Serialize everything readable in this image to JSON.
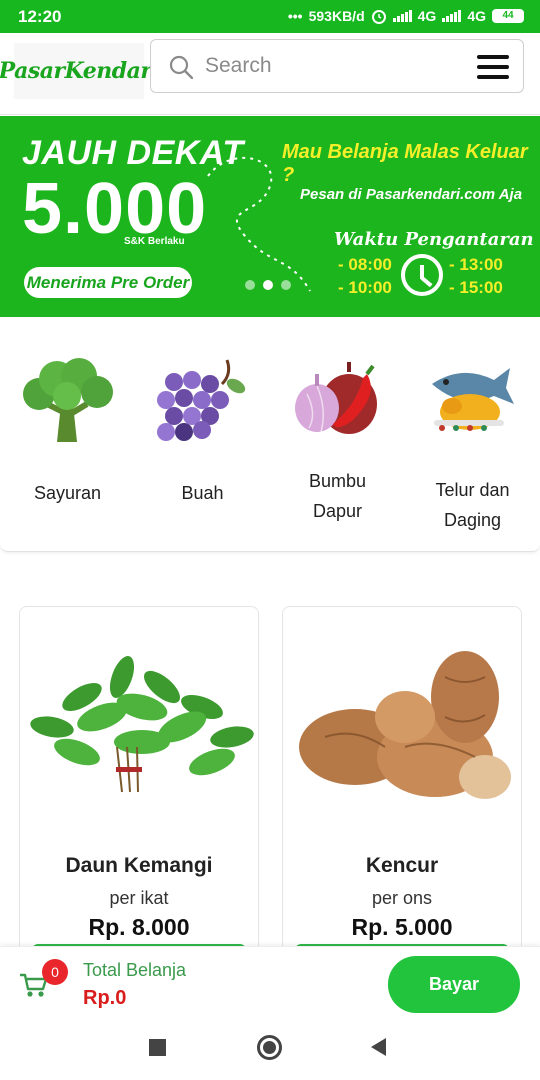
{
  "status_bar": {
    "time": "12:20",
    "dots": "•••",
    "network_speed": "593KB/d",
    "net1": "4G",
    "net2": "4G",
    "battery": "44"
  },
  "header": {
    "logo_text": "PasarKendari",
    "search_placeholder": "Search"
  },
  "banner": {
    "headline": "JAUH DEKAT",
    "price": "5.000",
    "terms": "S&K Berlaku",
    "preorder": "Menerima Pre Order",
    "question": "Mau Belanja Malas Keluar ?",
    "order_text": "Pesan di Pasarkendari.com Aja",
    "delivery_title": "Waktu Pengantaran",
    "times": [
      "- 08:00",
      "- 10:00",
      "- 13:00",
      "- 15:00"
    ]
  },
  "categories": [
    {
      "label_1": "Sayuran",
      "label_2": ""
    },
    {
      "label_1": "Buah",
      "label_2": ""
    },
    {
      "label_1": "Bumbu",
      "label_2": "Dapur"
    },
    {
      "label_1": "Telur dan",
      "label_2": "Daging"
    }
  ],
  "products": [
    {
      "name": "Daun Kemangi",
      "unit": "per ikat",
      "price": "Rp. 8.000"
    },
    {
      "name": "Kencur",
      "unit": "per ons",
      "price": "Rp. 5.000"
    }
  ],
  "cart": {
    "count": "0",
    "total_label": "Total Belanja",
    "total_value": "Rp.0",
    "pay_label": "Bayar"
  },
  "colors": {
    "brand_green": "#1db51d",
    "accent_yellow": "#f5ef2a",
    "price_red": "#d91c1c"
  },
  "icons": [
    "search-icon",
    "menu-icon",
    "cart-icon",
    "clock-icon",
    "recent-apps-icon",
    "home-icon",
    "back-icon"
  ]
}
